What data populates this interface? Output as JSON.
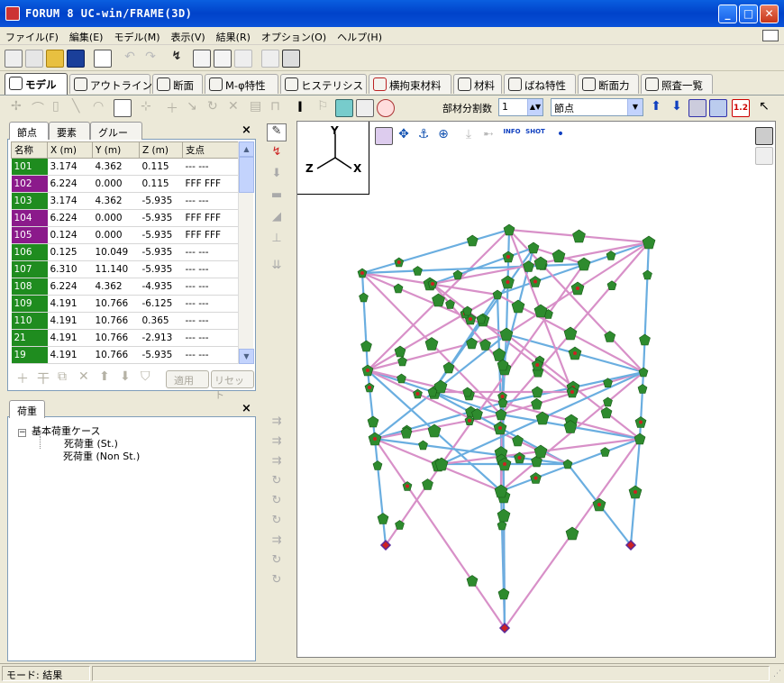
{
  "window": {
    "title": "FORUM 8  UC-win/FRAME(3D)",
    "minimize": "_",
    "maximize": "□",
    "close": "✕"
  },
  "menu": [
    "ファイル(F)",
    "編集(E)",
    "モデル(M)",
    "表示(V)",
    "結果(R)",
    "オプション(O)",
    "ヘルプ(H)"
  ],
  "tabs": [
    "モデル",
    "アウトライン",
    "断面",
    "M-φ特性",
    "ヒステリシス",
    "横拘束材料",
    "材料",
    "ばね特性",
    "断面力",
    "照査一覧"
  ],
  "toolbar2": {
    "division_label": "部材分割数",
    "division_value": "1",
    "node_select": "節点",
    "scale_label": "1.2"
  },
  "node_panel": {
    "tabs": [
      "節点",
      "要素",
      "グループ"
    ],
    "close": "×",
    "columns": [
      "名称",
      "X (m)",
      "Y (m)",
      "Z (m)",
      "支点"
    ],
    "rows": [
      {
        "id": "101",
        "x": "3.174",
        "y": "4.362",
        "z": "0.115",
        "support": "--- ---",
        "color": "#1f8c1f"
      },
      {
        "id": "102",
        "x": "6.224",
        "y": "0.000",
        "z": "0.115",
        "support": "FFF FFF",
        "color": "#8b1a8b"
      },
      {
        "id": "103",
        "x": "3.174",
        "y": "4.362",
        "z": "-5.935",
        "support": "--- ---",
        "color": "#1f8c1f"
      },
      {
        "id": "104",
        "x": "6.224",
        "y": "0.000",
        "z": "-5.935",
        "support": "FFF FFF",
        "color": "#8b1a8b"
      },
      {
        "id": "105",
        "x": "0.124",
        "y": "0.000",
        "z": "-5.935",
        "support": "FFF FFF",
        "color": "#8b1a8b"
      },
      {
        "id": "106",
        "x": "0.125",
        "y": "10.049",
        "z": "-5.935",
        "support": "--- ---",
        "color": "#1f8c1f"
      },
      {
        "id": "107",
        "x": "6.310",
        "y": "11.140",
        "z": "-5.935",
        "support": "--- ---",
        "color": "#1f8c1f"
      },
      {
        "id": "108",
        "x": "6.224",
        "y": "4.362",
        "z": "-4.935",
        "support": "--- ---",
        "color": "#1f8c1f"
      },
      {
        "id": "109",
        "x": "4.191",
        "y": "10.766",
        "z": "-6.125",
        "support": "--- ---",
        "color": "#1f8c1f"
      },
      {
        "id": "110",
        "x": "4.191",
        "y": "10.766",
        "z": "0.365",
        "support": "--- ---",
        "color": "#1f8c1f"
      },
      {
        "id": "21",
        "x": "4.191",
        "y": "10.766",
        "z": "-2.913",
        "support": "--- ---",
        "color": "#1f8c1f"
      },
      {
        "id": "19",
        "x": "4.191",
        "y": "10.766",
        "z": "-5.935",
        "support": "--- ---",
        "color": "#1f8c1f"
      }
    ],
    "apply": "適用",
    "reset": "リセット"
  },
  "load_panel": {
    "tab": "荷重",
    "close": "×",
    "root": "基本荷重ケース",
    "items": [
      "死荷重 (St.)",
      "死荷重 (Non St.)"
    ]
  },
  "axes": {
    "y": "Y",
    "z": "Z",
    "x": "X"
  },
  "viewport_tools": {
    "info": "INFO",
    "shot": "SHOT"
  },
  "status": {
    "mode_label": "モード: 結果"
  },
  "colors": {
    "node_green": "#2e8b2e",
    "member_blue": "#6aaee0",
    "member_pink": "#d890c8",
    "support_red": "#cc2222",
    "support_purple": "#5a2a9a"
  }
}
